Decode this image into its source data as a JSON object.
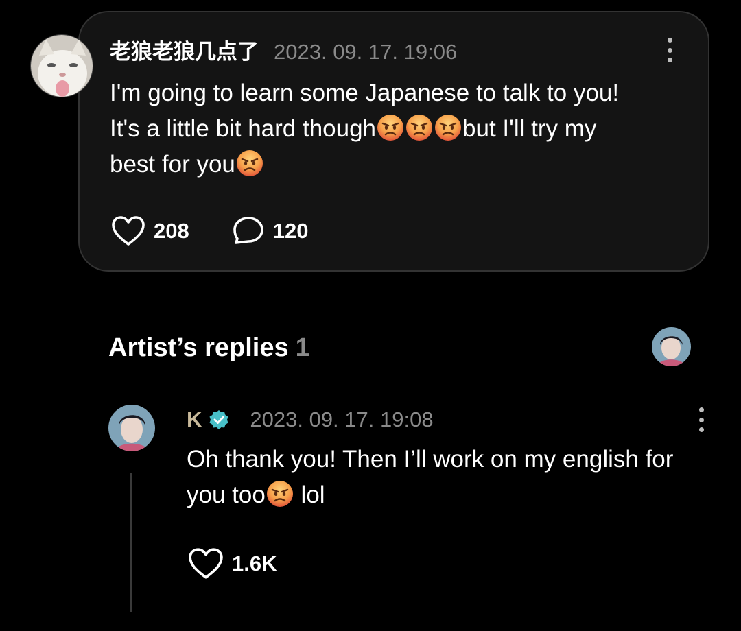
{
  "post": {
    "username": "老狼老狼几点了",
    "timestamp": "2023. 09. 17. 19:06",
    "text_line1": "I'm going to learn some Japanese to talk to you!",
    "text_line2_a": "It's a little bit hard though",
    "text_line2_b": "but I'll try my",
    "text_line3": "best for you",
    "likes": "208",
    "comments": "120",
    "avatar_icon": "cat-avatar",
    "emoji_icon": "angry-face-emoji"
  },
  "replies_section": {
    "title": "Artist’s replies",
    "count": "1"
  },
  "reply": {
    "username": "K",
    "verified_icon": "verified-badge-icon",
    "timestamp": "2023. 09. 17. 19:08",
    "text_a": "Oh thank you! Then I’ll work on my english for you too",
    "text_b": " lol",
    "likes": "1.6K"
  },
  "colors": {
    "background": "#000000",
    "card": "#141414",
    "card_border": "#333333",
    "muted_text": "#8a8a8a",
    "verified": "#48c0c8",
    "artist_name": "#c8b99a"
  }
}
